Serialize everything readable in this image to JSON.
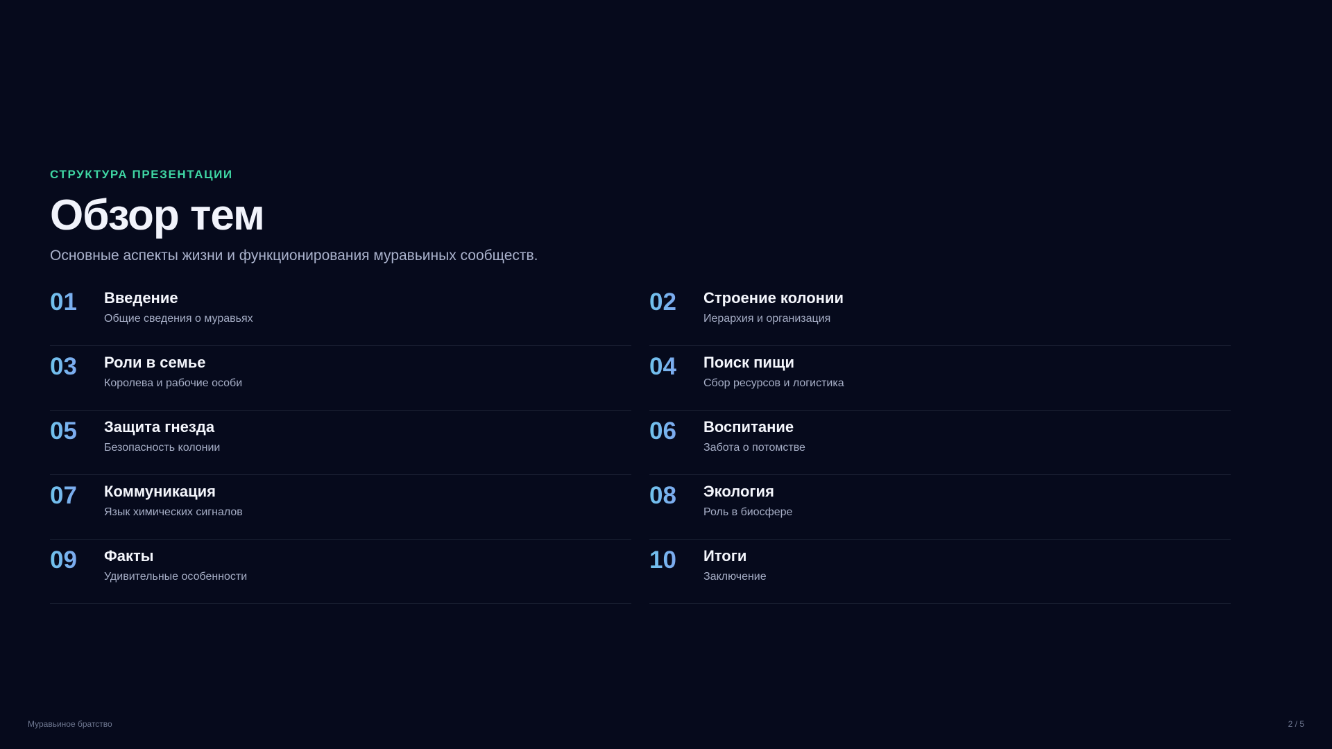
{
  "header": {
    "eyebrow": "СТРУКТУРА ПРЕЗЕНТАЦИИ",
    "title": "Обзор тем",
    "subtitle": "Основные аспекты жизни и функционирования муравьиных сообществ."
  },
  "topics": [
    {
      "number": "01",
      "title": "Введение",
      "description": "Общие сведения о муравьях"
    },
    {
      "number": "02",
      "title": "Строение колонии",
      "description": "Иерархия и организация"
    },
    {
      "number": "03",
      "title": "Роли в семье",
      "description": "Королева и рабочие особи"
    },
    {
      "number": "04",
      "title": "Поиск пищи",
      "description": "Сбор ресурсов и логистика"
    },
    {
      "number": "05",
      "title": "Защита гнезда",
      "description": "Безопасность колонии"
    },
    {
      "number": "06",
      "title": "Воспитание",
      "description": "Забота о потомстве"
    },
    {
      "number": "07",
      "title": "Коммуникация",
      "description": "Язык химических сигналов"
    },
    {
      "number": "08",
      "title": "Экология",
      "description": "Роль в биосфере"
    },
    {
      "number": "09",
      "title": "Факты",
      "description": "Удивительные особенности"
    },
    {
      "number": "10",
      "title": "Итоги",
      "description": "Заключение"
    }
  ],
  "footer": {
    "brand": "Муравьиное братство",
    "page": "2 / 5"
  },
  "colors": {
    "background": "#060a1c",
    "accent": "#3fd6a3",
    "number_gradient_start": "#6fc3ec",
    "number_gradient_end": "#8b8ff2"
  }
}
